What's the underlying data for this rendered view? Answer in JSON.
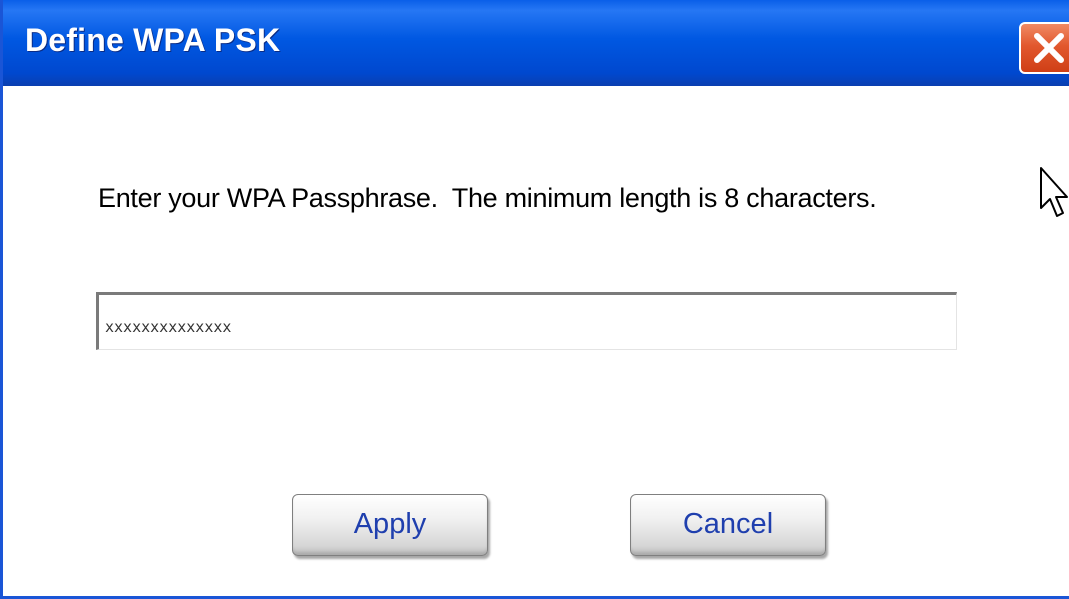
{
  "dialog": {
    "title": "Define WPA PSK",
    "close_label": "Close",
    "instruction": "Enter your WPA Passphrase.  The minimum length is 8 characters.",
    "passphrase_value": "xxxxxxxxxxxxxx",
    "passphrase_placeholder": "",
    "apply_label": "Apply",
    "cancel_label": "Cancel"
  },
  "icons": {
    "close": "close-icon",
    "cursor": "mouse-pointer-icon"
  },
  "colors": {
    "titlebar": "#0058e2",
    "close_button": "#e2582e",
    "button_text": "#1f3fae"
  }
}
